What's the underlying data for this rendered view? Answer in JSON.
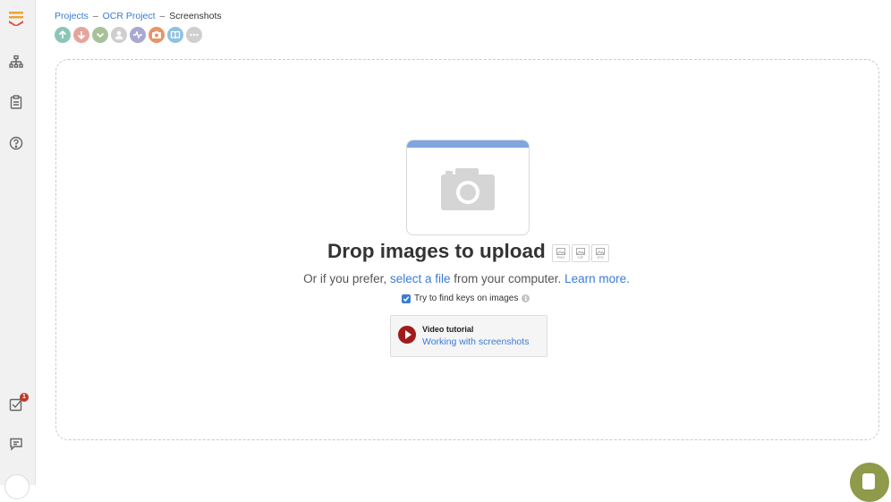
{
  "sidebar": {
    "items": [
      {
        "name": "menu-logo-icon"
      },
      {
        "name": "structure-icon"
      },
      {
        "name": "clipboard-icon"
      },
      {
        "name": "help-icon"
      },
      {
        "name": "tasks-icon",
        "badge": "1"
      },
      {
        "name": "comments-icon"
      }
    ]
  },
  "breadcrumb": {
    "projects": "Projects",
    "sep1": "–",
    "project": "OCR Project",
    "sep2": "–",
    "current": "Screenshots"
  },
  "toolbar": {
    "buttons": [
      {
        "name": "upload-icon",
        "color": "#8cc5b8"
      },
      {
        "name": "download-icon",
        "color": "#e4a59c"
      },
      {
        "name": "checkmark-icon",
        "color": "#a9c19b"
      },
      {
        "name": "user-icon",
        "color": "#cfcfcf"
      },
      {
        "name": "activity-icon",
        "color": "#a8a8d2"
      },
      {
        "name": "camera-icon",
        "color": "#e89466"
      },
      {
        "name": "book-icon",
        "color": "#8fc1e0"
      },
      {
        "name": "more-icon",
        "color": "#cfcfcf"
      }
    ]
  },
  "dropzone": {
    "title": "Drop images to upload",
    "formats": [
      "PNG",
      "GIF",
      "JPG"
    ],
    "prefix": "Or if you prefer,",
    "select_link": "select a file",
    "middle": "from your computer.",
    "learn_more": "Learn more.",
    "checkbox_label": "Try to find keys on images",
    "checkbox_checked": true,
    "info_symbol": "i",
    "video_label": "Video tutorial",
    "video_link": "Working with screenshots"
  },
  "colors": {
    "link": "#3a7bd5",
    "accent_bar": "#7fa6de",
    "play": "#a01c1c",
    "chat": "#8f9a4a"
  }
}
